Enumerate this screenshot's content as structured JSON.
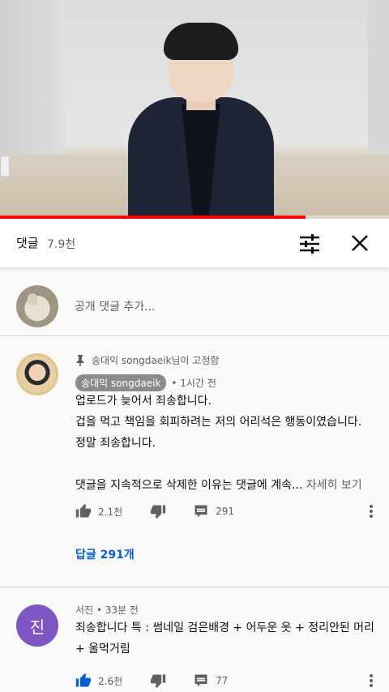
{
  "video": {
    "progress_percent": 78.5
  },
  "comments_header": {
    "title": "댓글",
    "count": "7.9천",
    "filter_icon": "tune-icon",
    "close_icon": "close-icon"
  },
  "add_comment": {
    "placeholder": "공개 댓글 추가..."
  },
  "pinned_comment": {
    "pinned_label": "송대익 songdaeik님이 고정함",
    "author": "송대익 songdaeik",
    "time": "• 1시간 전",
    "lines": [
      "업로드가 늦어서 죄송합니다.",
      "겁을 먹고 책임을 회피하려는 저의 어리석은 행동이였습니다.",
      "정말 죄송합니다.",
      "",
      "댓글을 지속적으로 삭제한 이유는 댓글에 계속..."
    ],
    "read_more": "자세히 보기",
    "likes": "2.1천",
    "reply_count": "291",
    "replies_link": "답글 291개"
  },
  "second_comment": {
    "avatar_letter": "진",
    "author_time": "서진 • 33분 전",
    "lines": [
      "죄송합니다 특 : 썸네일 검은배경 + 어두운 옷 + 정리안된 머리",
      "+ 울먹거림"
    ],
    "likes": "2.6천",
    "reply_count": "77"
  },
  "colors": {
    "progress": "#ff0000",
    "link_blue": "#065fd4",
    "avatar_purple": "#7e57c2",
    "liked_blue": "#065fd4"
  }
}
